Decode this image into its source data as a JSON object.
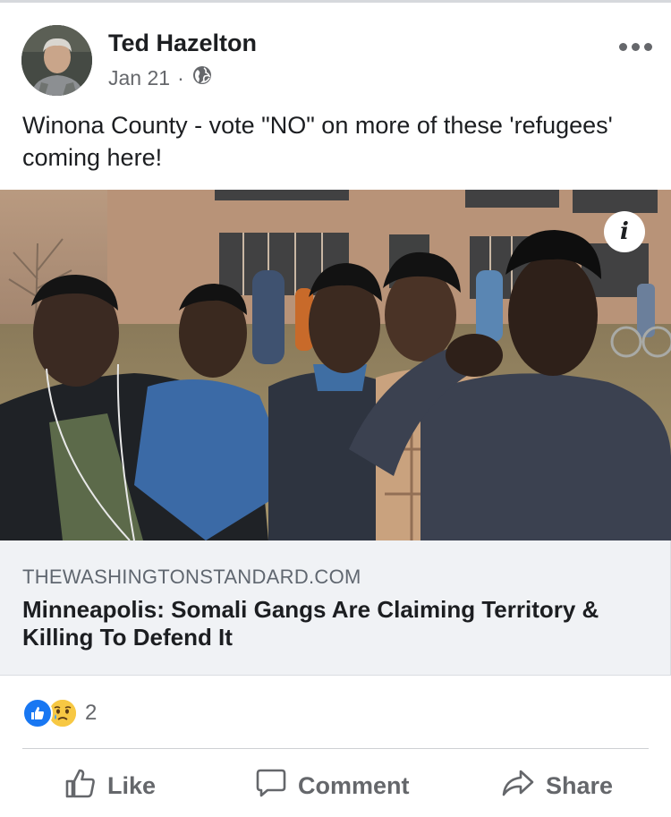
{
  "post": {
    "author": "Ted Hazelton",
    "date": "Jan 21",
    "separator": "·",
    "privacy_icon": "globe-icon",
    "text": "Winona County - vote \"NO\" on more of these 'refugees' coming here!"
  },
  "link_preview": {
    "domain": "THEWASHINGTONSTANDARD.COM",
    "title": "Minneapolis: Somali Gangs Are Claiming Territory & Killing To Defend It",
    "info_glyph": "i"
  },
  "reactions": {
    "types": [
      "like-reaction-icon",
      "sad-reaction-icon"
    ],
    "count": "2"
  },
  "actions": {
    "like": "Like",
    "comment": "Comment",
    "share": "Share"
  },
  "colors": {
    "accent": "#1877f2",
    "secondary_text": "#65676b",
    "link_box_bg": "#f0f2f5"
  }
}
